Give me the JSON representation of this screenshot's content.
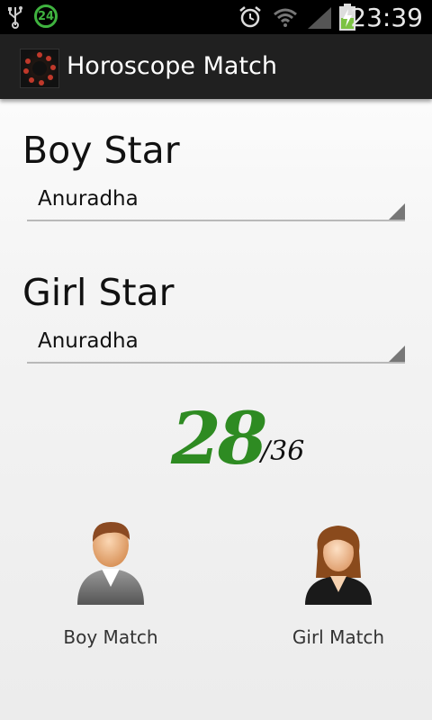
{
  "status_bar": {
    "notification_badge": "24",
    "time": "23:39",
    "icons": [
      "usb-icon",
      "alarm-icon",
      "wifi-icon",
      "signal-icon",
      "battery-icon"
    ]
  },
  "action_bar": {
    "title": "Horoscope Match",
    "app_icon": "zodiac-wheel-icon"
  },
  "boy": {
    "label": "Boy Star",
    "selected": "Anuradha"
  },
  "girl": {
    "label": "Girl Star",
    "selected": "Anuradha"
  },
  "score": {
    "value": "28",
    "total": "/36",
    "color": "#2e8b22"
  },
  "buttons": {
    "boy_match": "Boy Match",
    "girl_match": "Girl Match"
  }
}
